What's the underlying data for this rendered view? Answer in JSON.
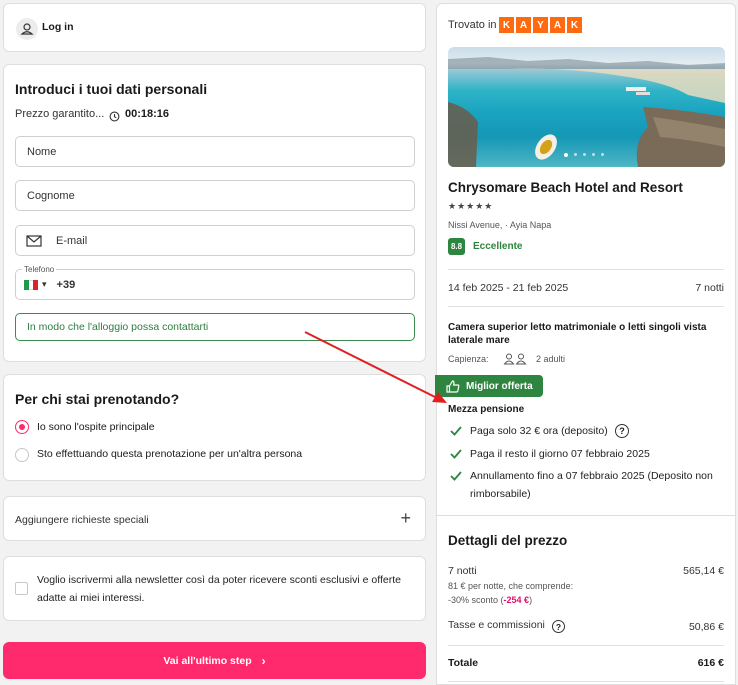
{
  "login": {
    "label": "Log in"
  },
  "personal": {
    "title": "Introduci i tuoi dati personali",
    "price_guarantee": "Prezzo garantito...",
    "timer": "00:18:16",
    "name_placeholder": "Nome",
    "surname_placeholder": "Cognome",
    "email_placeholder": "E-mail",
    "phone_label": "Telefono",
    "phone_prefix": "+39",
    "phone_hint": "In modo che l'alloggio possa contattarti"
  },
  "booking_for": {
    "title": "Per chi stai prenotando?",
    "option_main": "Io sono l'ospite principale",
    "option_other": "Sto effettuando questa prenotazione per un'altra persona"
  },
  "special_requests": {
    "label": "Aggiungere richieste speciali"
  },
  "newsletter": {
    "label": "Voglio iscrivermi alla newsletter così da poter ricevere sconti esclusivi e offerte adatte ai miei interessi."
  },
  "cta": {
    "label": "Vai all'ultimo step"
  },
  "hotel": {
    "found_in": "Trovato in",
    "brand_letters": [
      "K",
      "A",
      "Y",
      "A",
      "K"
    ],
    "name": "Chrysomare Beach Hotel and Resort",
    "stars": 5,
    "address": "Nissi Avenue, · Ayia Napa",
    "score": "8.8",
    "score_label": "Eccellente",
    "dates": "14 feb 2025 - 21 feb 2025",
    "nights": "7 notti",
    "room": "Camera superior letto matrimoniale o letti singoli vista laterale mare",
    "capacity_label": "Capienza:",
    "capacity_value": "2 adulti",
    "best_offer": "Miglior offerta",
    "board": "Mezza pensione",
    "conditions": [
      "Paga solo 32 € ora (deposito)",
      "Paga il resto il giorno 07 febbraio 2025",
      "Annullamento fino a 07 febbraio 2025 (Deposito non rimborsabile)"
    ]
  },
  "price": {
    "title": "Dettagli del prezzo",
    "nights_label": "7 notti",
    "nights_value": "565,14 €",
    "per_night": "81 € per notte, che comprende:",
    "discount_text": "-30% sconto (",
    "discount_value": "-254 €",
    "discount_close": ")",
    "taxes_label": "Tasse e commissioni",
    "taxes_value": "50,86 €",
    "total_label": "Totale",
    "total_value": "616 €"
  },
  "colors": {
    "accent": "#ff2a6d",
    "kayak": "#ff690f",
    "green": "#2e8540",
    "arrow": "#e02020"
  }
}
